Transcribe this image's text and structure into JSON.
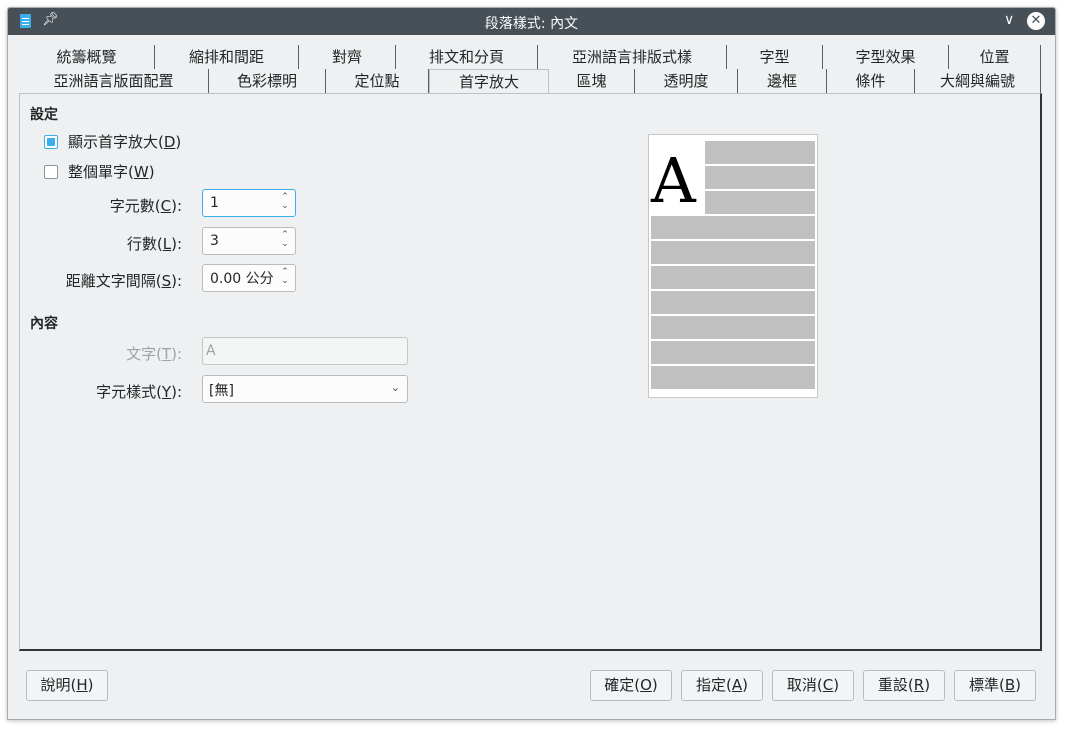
{
  "window": {
    "title": "段落樣式: 內文"
  },
  "tabs": {
    "row1": [
      "統籌概覽",
      "縮排和間距",
      "對齊",
      "排文和分頁",
      "亞洲語言排版式樣",
      "字型",
      "字型效果",
      "位置"
    ],
    "row2": [
      "亞洲語言版面配置",
      "色彩標明",
      "定位點",
      "首字放大",
      "區塊",
      "透明度",
      "邊框",
      "條件",
      "大綱與編號"
    ],
    "active": "首字放大"
  },
  "settings": {
    "section_title": "設定",
    "show_dropcap": {
      "label": "顯示首字放大(",
      "key": "D",
      "suffix": ")",
      "checked": true
    },
    "whole_word": {
      "label": "整個單字(",
      "key": "W",
      "suffix": ")",
      "checked": false
    },
    "characters": {
      "label": "字元數(",
      "key": "C",
      "suffix": "):",
      "value": "1"
    },
    "lines": {
      "label": "行數(",
      "key": "L",
      "suffix": "):",
      "value": "3"
    },
    "spacing": {
      "label": "距離文字間隔(",
      "key": "S",
      "suffix": "):",
      "value": "0.00 公分"
    }
  },
  "contents": {
    "section_title": "內容",
    "text": {
      "label": "文字(",
      "key": "T",
      "suffix": "):",
      "value": "A"
    },
    "char_style": {
      "label": "字元樣式(",
      "key": "Y",
      "suffix": "):",
      "value": "[無]"
    }
  },
  "preview": {
    "dropcap_letter": "A"
  },
  "buttons": {
    "help": {
      "label": "說明(",
      "key": "H",
      "suffix": ")"
    },
    "ok": {
      "label": "確定(",
      "key": "O",
      "suffix": ")"
    },
    "apply": {
      "label": "指定(",
      "key": "A",
      "suffix": ")"
    },
    "cancel": {
      "label": "取消(",
      "key": "C",
      "suffix": ")"
    },
    "reset": {
      "label": "重設(",
      "key": "R",
      "suffix": ")"
    },
    "standard": {
      "label": "標準(",
      "key": "B",
      "suffix": ")"
    }
  },
  "colors": {
    "titlebar": "#475057",
    "accent": "#3daee9",
    "panel_bg": "#eff0f1"
  }
}
